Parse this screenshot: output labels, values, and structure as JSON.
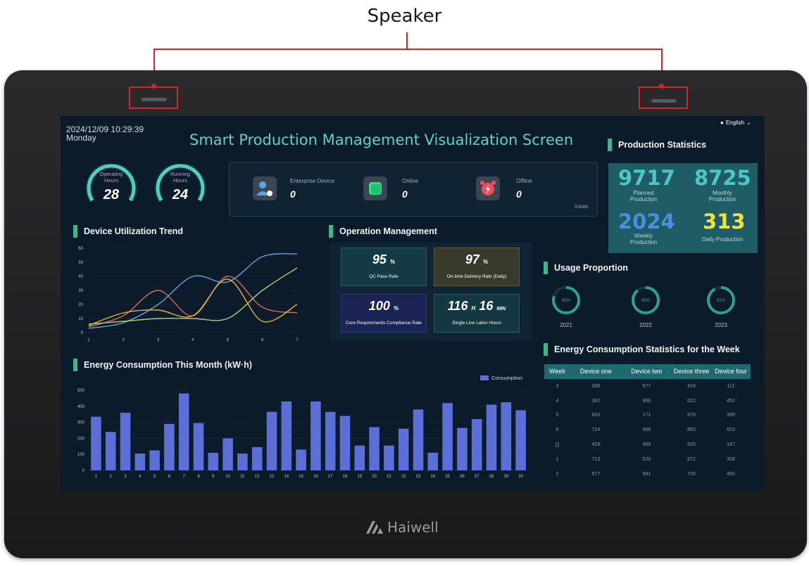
{
  "callout": {
    "label": "Speaker"
  },
  "brand": {
    "name": "Haiwell"
  },
  "screen": {
    "datetime": "2024/12/09 10:29:39",
    "weekday": "Monday",
    "title": "Smart Production Management Visualization Screen",
    "language": "English",
    "gauges": [
      {
        "label_line1": "Operating",
        "label_line2": "Hours",
        "value": "28"
      },
      {
        "label_line1": "Running",
        "label_line2": "Hours",
        "value": "24"
      }
    ],
    "devices": {
      "enterprise_label": "Enterprise Device",
      "enterprise_value": "0",
      "online_label": "Online",
      "online_value": "0",
      "offline_label": "Offline",
      "offline_value": "0",
      "unit": "/Units"
    },
    "production_statistics": {
      "title": "Production Statistics",
      "planned_value": "9717",
      "planned_label_1": "Planned",
      "planned_label_2": "Production",
      "monthly_value": "8725",
      "monthly_label_1": "Monthly",
      "monthly_label_2": "Production",
      "weekly_value": "2024",
      "weekly_label_1": "Weekly",
      "weekly_label_2": "Production",
      "daily_value": "313",
      "daily_label": "Daily Production",
      "colors": {
        "planned": "#4ec7c4",
        "monthly": "#4ec7c4",
        "weekly": "#4a8fe0",
        "daily": "#f2e33c"
      }
    },
    "utilization": {
      "title": "Device Utilization Trend"
    },
    "operation": {
      "title": "Operation Management",
      "qc_value": "95",
      "qc_unit": "%",
      "qc_label": "QC Pass Rate",
      "ontime_value": "97",
      "ontime_unit": "%",
      "ontime_label": "On-time Delivery Rate (Daily)",
      "core_value": "100",
      "core_unit": "%",
      "core_label": "Core Requirements Compliance Rate",
      "labor_hours": "116",
      "labor_h_unit": "H",
      "labor_minutes": "16",
      "labor_m_unit": "MIN",
      "labor_label": "Single Line Labor Hours"
    },
    "usage": {
      "title": "Usage Proportion",
      "items": [
        {
          "year": "2021",
          "percent_label": "80%",
          "value": 0.8
        },
        {
          "year": "2022",
          "percent_label": "89%",
          "value": 0.89
        },
        {
          "year": "2023",
          "percent_label": "92%",
          "value": 0.92
        }
      ]
    },
    "energy_month": {
      "title": "Energy Consumption This Month (kW·h)",
      "legend": "Consumption"
    },
    "energy_week": {
      "title": "Energy Consumption Statistics for the Week",
      "headers": [
        "Week",
        "Device one",
        "Device two",
        "Device three",
        "Device four"
      ],
      "rows": [
        [
          "3",
          "385",
          "677",
          "416",
          "112"
        ],
        [
          "4",
          "362",
          "966",
          "622",
          "452"
        ],
        [
          "5",
          "652",
          "171",
          "678",
          "399"
        ],
        [
          "6",
          "724",
          "968",
          "865",
          "653"
        ],
        [
          "日",
          "429",
          "889",
          "926",
          "147"
        ],
        [
          "1",
          "713",
          "520",
          "872",
          "358"
        ],
        [
          "2",
          "577",
          "981",
          "726",
          "450"
        ]
      ]
    }
  },
  "chart_data": [
    {
      "type": "line",
      "title": "Device Utilization Trend",
      "x": [
        1,
        2,
        3,
        4,
        5,
        6,
        7
      ],
      "ylim": [
        0,
        60
      ],
      "yticks": [
        0,
        10,
        20,
        30,
        40,
        50,
        60
      ],
      "series": [
        {
          "color": "#d86a5a",
          "values": [
            4,
            12,
            30,
            12,
            40,
            18,
            14
          ]
        },
        {
          "color": "#5ea9d6",
          "values": [
            3,
            7,
            20,
            40,
            36,
            54,
            56
          ]
        },
        {
          "color": "#e0b847",
          "values": [
            5,
            14,
            16,
            12,
            38,
            8,
            20
          ]
        },
        {
          "color": "#b6cc7a",
          "values": [
            6,
            8,
            10,
            10,
            10,
            30,
            46
          ]
        }
      ]
    },
    {
      "type": "bar",
      "title": "Energy Consumption This Month (kW·h)",
      "categories": [
        "1",
        "2",
        "3",
        "4",
        "5",
        "6",
        "7",
        "8",
        "9",
        "10",
        "11",
        "12",
        "13",
        "14",
        "15",
        "16",
        "17",
        "18",
        "19",
        "20",
        "21",
        "22",
        "23",
        "24",
        "25",
        "26",
        "27",
        "28",
        "29",
        "30"
      ],
      "series": [
        {
          "name": "Consumption",
          "color": "#5b6fd6",
          "values": [
            335,
            240,
            360,
            105,
            125,
            290,
            480,
            295,
            110,
            200,
            105,
            145,
            365,
            430,
            130,
            430,
            365,
            340,
            155,
            270,
            155,
            260,
            380,
            110,
            420,
            265,
            320,
            410,
            425,
            375
          ]
        }
      ],
      "ylim": [
        0,
        500
      ],
      "yticks": [
        0,
        100,
        200,
        300,
        400,
        500
      ]
    }
  ]
}
